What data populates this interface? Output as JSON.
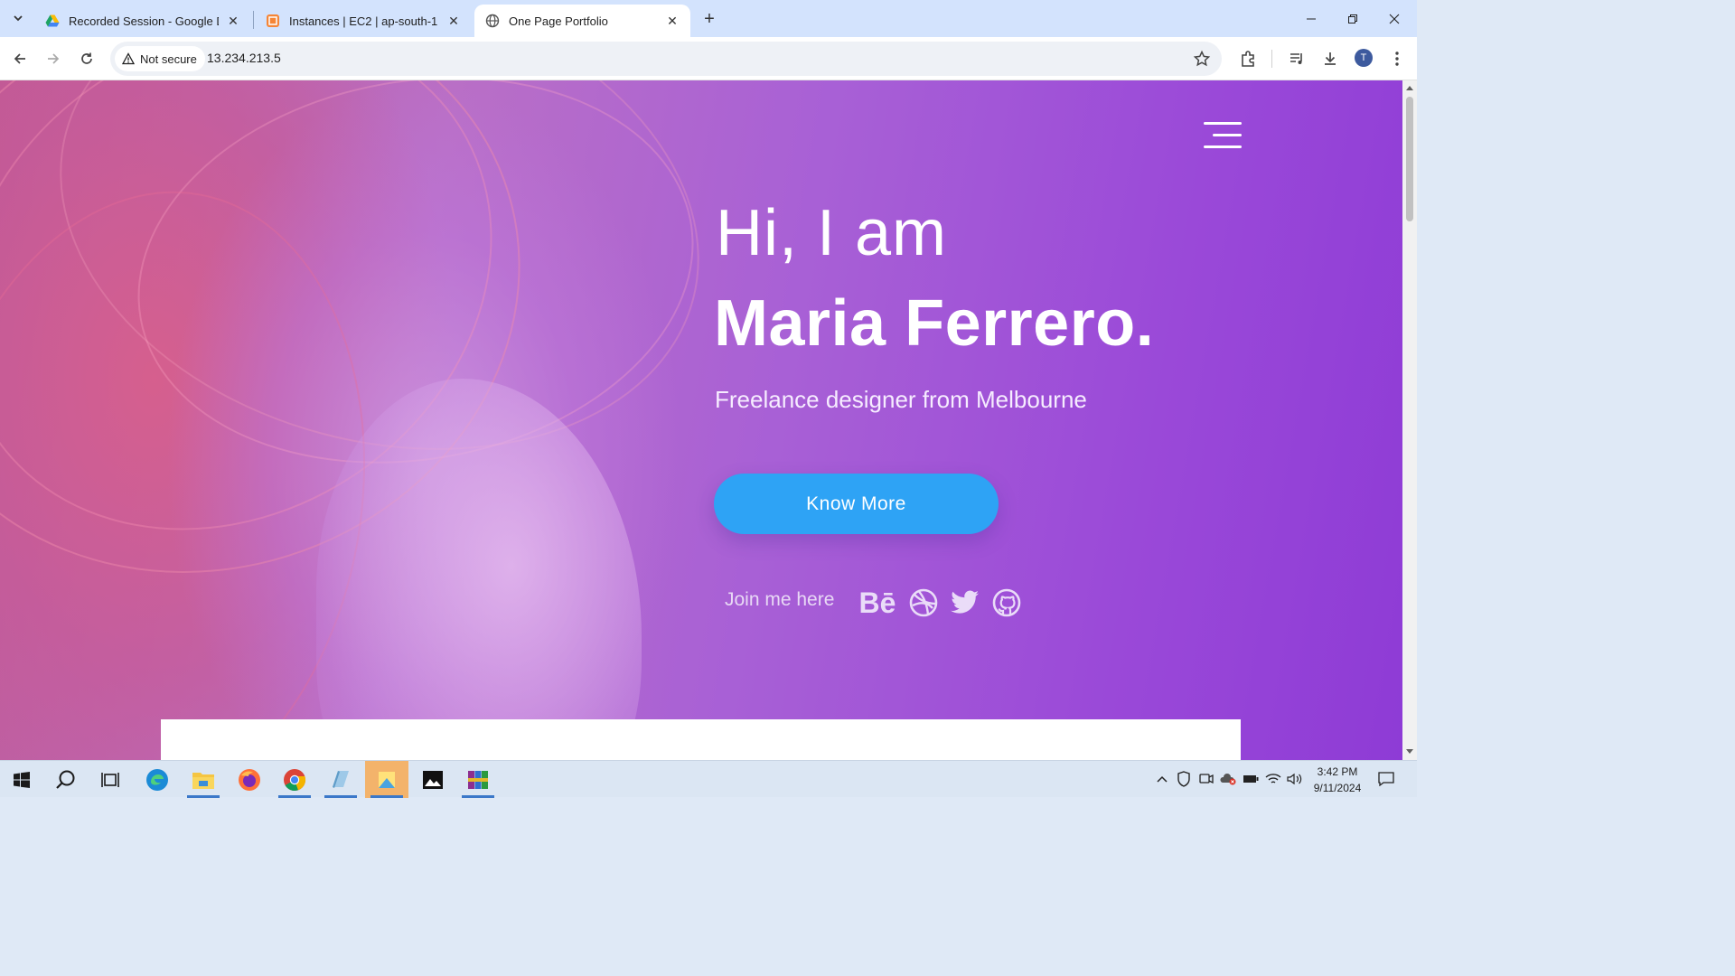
{
  "browser": {
    "tabs": [
      {
        "title": "Recorded Session - Google Driv",
        "icon": "google-drive-icon"
      },
      {
        "title": "Instances | EC2 | ap-south-1",
        "icon": "aws-icon"
      },
      {
        "title": "One Page Portfolio",
        "icon": "globe-icon",
        "active": true
      }
    ],
    "security_label": "Not secure",
    "url": "13.234.213.5",
    "profile_initial": "T"
  },
  "hero": {
    "greeting": "Hi, I am",
    "name": "Maria Ferrero.",
    "tagline": "Freelance designer from Melbourne",
    "cta_label": "Know More",
    "social_label": "Join me here",
    "social_icons": [
      "behance-icon",
      "dribbble-icon",
      "twitter-icon",
      "github-icon"
    ],
    "behance_text": "Bē"
  },
  "colors": {
    "cta": "#2ea3f5",
    "gradient_end": "#8e3bd6"
  },
  "taskbar": {
    "time": "3:42 PM",
    "date": "9/11/2024"
  }
}
